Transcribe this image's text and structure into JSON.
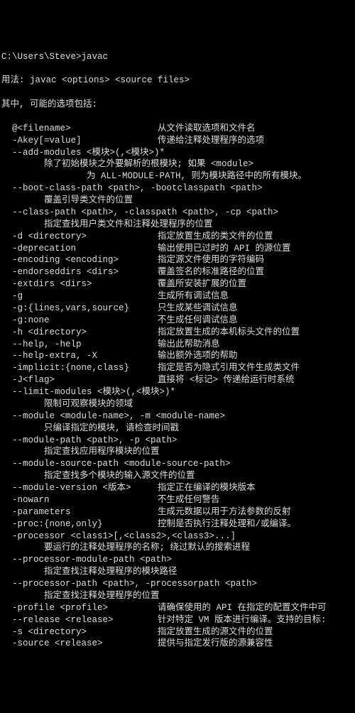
{
  "prompt": "C:\\Users\\Steve>javac",
  "usage_line": "用法: javac <options> <source files>",
  "options_intro": "其中, 可能的选项包括:",
  "lines": [
    {
      "left": "  @<filename>",
      "right": "从文件读取选项和文件名"
    },
    {
      "left": "  -Akey[=value]",
      "right": "传递给注释处理程序的选项"
    },
    {
      "full": "  --add-modules <模块>(,<模块>)*"
    },
    {
      "full": "        除了初始模块之外要解析的根模块; 如果 <module>"
    },
    {
      "full": "                为 ALL-MODULE-PATH, 则为模块路径中的所有模块。"
    },
    {
      "full": "  --boot-class-path <path>, -bootclasspath <path>"
    },
    {
      "full": "        覆盖引导类文件的位置"
    },
    {
      "full": "  --class-path <path>, -classpath <path>, -cp <path>"
    },
    {
      "full": "        指定查找用户类文件和注释处理程序的位置"
    },
    {
      "left": "  -d <directory>",
      "right": "指定放置生成的类文件的位置"
    },
    {
      "left": "  -deprecation",
      "right": "输出使用已过时的 API 的源位置"
    },
    {
      "left": "  -encoding <encoding>",
      "right": "指定源文件使用的字符编码"
    },
    {
      "left": "  -endorseddirs <dirs>",
      "right": "覆盖签名的标准路径的位置"
    },
    {
      "left": "  -extdirs <dirs>",
      "right": "覆盖所安装扩展的位置"
    },
    {
      "left": "  -g",
      "right": "生成所有调试信息"
    },
    {
      "left": "  -g:{lines,vars,source}",
      "right": "只生成某些调试信息"
    },
    {
      "left": "  -g:none",
      "right": "不生成任何调试信息"
    },
    {
      "left": "  -h <directory>",
      "right": "指定放置生成的本机标头文件的位置"
    },
    {
      "left": "  --help, -help",
      "right": "输出此帮助消息"
    },
    {
      "left": "  --help-extra, -X",
      "right": "输出额外选项的帮助"
    },
    {
      "left": "  -implicit:{none,class}",
      "right": "指定是否为隐式引用文件生成类文件"
    },
    {
      "left": "  -J<flag>",
      "right": "直接将 <标记> 传递给运行时系统"
    },
    {
      "full": "  --limit-modules <模块>(,<模块>)*"
    },
    {
      "full": "        限制可观察模块的领域"
    },
    {
      "full": "  --module <module-name>, -m <module-name>"
    },
    {
      "full": "        只编译指定的模块, 请检查时间戳"
    },
    {
      "full": "  --module-path <path>, -p <path>"
    },
    {
      "full": "        指定查找应用程序模块的位置"
    },
    {
      "full": "  --module-source-path <module-source-path>"
    },
    {
      "full": "        指定查找多个模块的输入源文件的位置"
    },
    {
      "left": "  --module-version <版本>",
      "right": "指定正在编译的模块版本"
    },
    {
      "left": "  -nowarn",
      "right": "不生成任何警告"
    },
    {
      "left": "  -parameters",
      "right": "生成元数据以用于方法参数的反射"
    },
    {
      "left": "  -proc:{none,only}",
      "right": "控制是否执行注释处理和/或编译。"
    },
    {
      "full": "  -processor <class1>[,<class2>,<class3>...]"
    },
    {
      "full": "        要运行的注释处理程序的名称; 绕过默认的搜索进程"
    },
    {
      "full": "  --processor-module-path <path>"
    },
    {
      "full": "        指定查找注释处理程序的模块路径"
    },
    {
      "full": "  --processor-path <path>, -processorpath <path>"
    },
    {
      "full": "        指定查找注释处理程序的位置"
    },
    {
      "left": "  -profile <profile>",
      "right": "请确保使用的 API 在指定的配置文件中可"
    },
    {
      "left": "  --release <release>",
      "right": "针对特定 VM 版本进行编译。支持的目标:"
    },
    {
      "left": "  -s <directory>",
      "right": "指定放置生成的源文件的位置"
    },
    {
      "left": "  -source <release>",
      "right": "提供与指定发行版的源兼容性"
    }
  ]
}
